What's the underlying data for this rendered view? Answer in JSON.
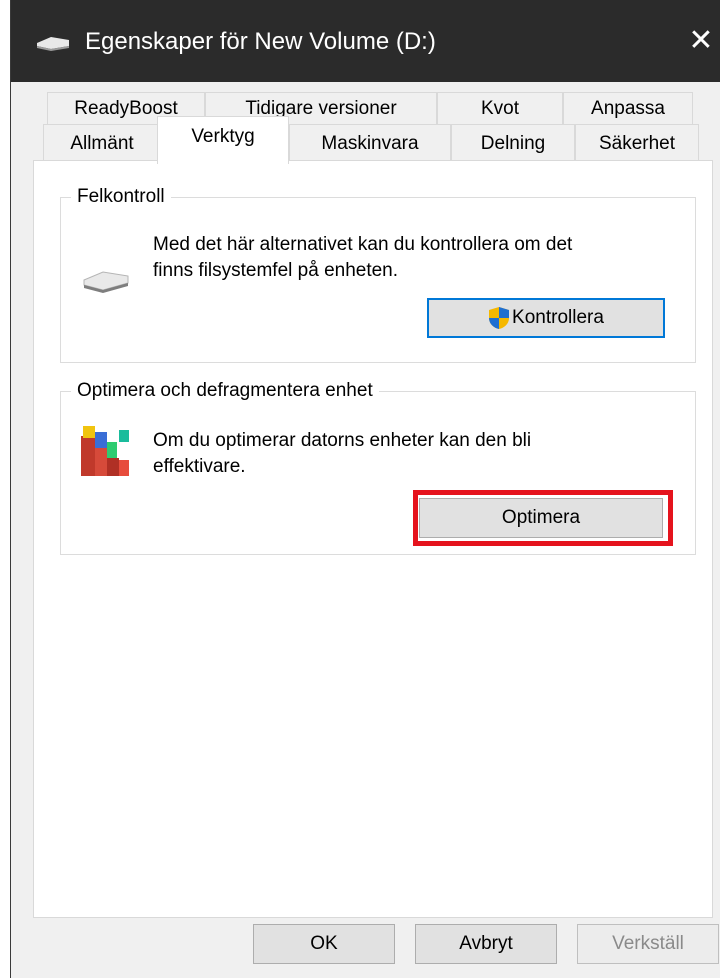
{
  "window": {
    "title": "Egenskaper för New Volume (D:)",
    "close_glyph": "✕"
  },
  "tabs": {
    "row1": [
      "ReadyBoost",
      "Tidigare versioner",
      "Kvot",
      "Anpassa"
    ],
    "row2": [
      "Allmänt",
      "Verktyg",
      "Maskinvara",
      "Delning",
      "Säkerhet"
    ],
    "active": "Verktyg"
  },
  "error_check": {
    "title": "Felkontroll",
    "description_line1": "Med det här alternativet kan du kontrollera om det",
    "description_line2": "finns filsystemfel på enheten.",
    "button_label": "Kontrollera",
    "icon": "drive-icon",
    "button_icon": "uac-shield-icon"
  },
  "optimize": {
    "title": "Optimera och defragmentera enhet",
    "description_line1": "Om du optimerar datorns enheter kan den bli",
    "description_line2": "effektivare.",
    "button_label": "Optimera",
    "icon": "defrag-icon",
    "highlight_color": "#e5131d"
  },
  "footer": {
    "ok_label": "OK",
    "cancel_label": "Avbryt",
    "apply_label": "Verkställ"
  }
}
